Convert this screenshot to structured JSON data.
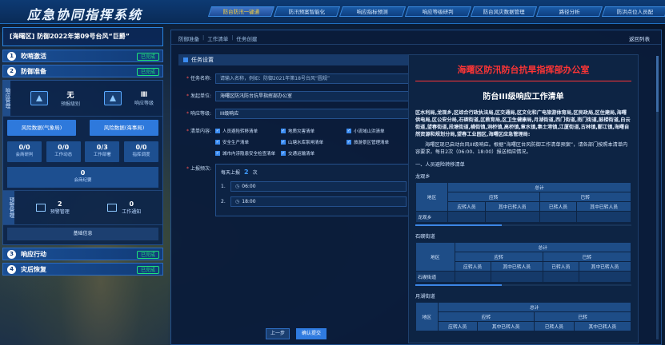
{
  "app": {
    "title": "应急协同指挥系统"
  },
  "nav": [
    {
      "label": "防台防汛一键通",
      "active": true
    },
    {
      "label": "防汛预案智能化",
      "active": false
    },
    {
      "label": "响应指标预测",
      "active": false
    },
    {
      "label": "响应等级研判",
      "active": false
    },
    {
      "label": "防台风灾数据管理",
      "active": false
    },
    {
      "label": "路径分析",
      "active": false
    },
    {
      "label": "防洪点位人员配",
      "active": false
    }
  ],
  "left": {
    "alert_title": "[海曙区] 防御2022年第09号台风“巨爵”",
    "stages": [
      {
        "num": "1",
        "label": "吹哨激活",
        "badge": "已完成"
      },
      {
        "num": "2",
        "label": "防御准备",
        "badge": "已完成"
      },
      {
        "num": "3",
        "label": "响应行动",
        "badge": "已完成"
      },
      {
        "num": "4",
        "label": "灾后恢复",
        "badge": "已完成"
      }
    ],
    "response": {
      "side_label": "响应管理",
      "level_value": "无",
      "level_label": "预报级别",
      "grade_value": "Ⅲ",
      "grade_label": "响应等级"
    },
    "buttons": {
      "left": "风险数据(气象局)",
      "right": "风险数据(海事局)"
    },
    "stats": [
      {
        "value": "0/0",
        "label": "会商研判"
      },
      {
        "value": "0/0",
        "label": "工作动态"
      },
      {
        "value": "0/3",
        "label": "工作部署"
      },
      {
        "value": "0/0",
        "label": "指挥调度"
      }
    ],
    "wide_stat": {
      "value": "0",
      "label": "会商纪要"
    },
    "warning": {
      "side_label": "预警管理",
      "items": [
        {
          "value": "2",
          "label": "预警管理"
        },
        {
          "value": "0",
          "label": "工作通知"
        }
      ]
    },
    "base_info": "基础信息"
  },
  "main": {
    "crumbs": [
      "防御准备",
      "工作清单",
      "任务创建"
    ],
    "back": "返回列表",
    "section_title": "任务设置",
    "form": {
      "task_name_label": "任务名称:",
      "task_name_placeholder": "请输入名称，例如：防御2021年第18号台风“圆规”",
      "issuer_label": "发起单位:",
      "issuer_value": "海曙区防汛防台抗旱指挥部办公室",
      "level_label": "响应等级:",
      "level_value": "III级响应",
      "list_label": "清单内容:",
      "list_items": [
        "人员避险转移清单",
        "地质灾害清单",
        "小流域山洪清单",
        "安全生产清单",
        "山塘水库泵闸清单",
        "旅游景区管理清单",
        "城市内涝隐患安全检查清单",
        "交通运输清单"
      ],
      "report_label": "上报频次:",
      "every_prefix": "每天上报",
      "every_num": "2",
      "every_suffix": "次",
      "times": [
        {
          "idx": "1.",
          "value": "06:00"
        },
        {
          "idx": "2.",
          "value": "18:00"
        }
      ]
    },
    "buttons": {
      "prev": "上一步",
      "confirm": "确认提交"
    },
    "document": {
      "org": "海曙区防汛防台抗旱指挥部办公室",
      "title": "防台III级响应工作清单",
      "recipients": "区水利局,龙观乡,区综合行政执法局,区交通局,区文化和广电旅游体育局,区民政局,区住建局,海曙供电局,区公安分局,石碶街道,区教育局,区卫生健康局,月湖街道,西门街道,南门街道,鼓楼街道,白云街道,望春街道,段塘街道,横街镇,洞桥镇,高桥镇,章水镇,集士港镇,江厦街道,古林镇,鄞江镇,海曙自然资源和规划分局,望春工业园区,海曙区应急管理局:",
      "body": "海曙区现已启动台风III级响应。根据“海曙区台风防御工作清单预案”，请各部门按照本清单内容要求，每日2次（06:00、18:00）报送相应情况。",
      "section": "一、人员避险转移清单",
      "areas": [
        {
          "name": "龙观乡",
          "row": "龙观乡"
        },
        {
          "name": "石碶街道",
          "row": "石碶街道"
        },
        {
          "name": "月湖街道",
          "row": ""
        }
      ],
      "table_heads": {
        "area": "地区",
        "total": "总计",
        "should": "应转",
        "done": "已转",
        "should_people": "应转人员",
        "people_incl": "其中已转人员",
        "done_people": "已转人员",
        "done_incl": "其中已转人员"
      }
    }
  }
}
